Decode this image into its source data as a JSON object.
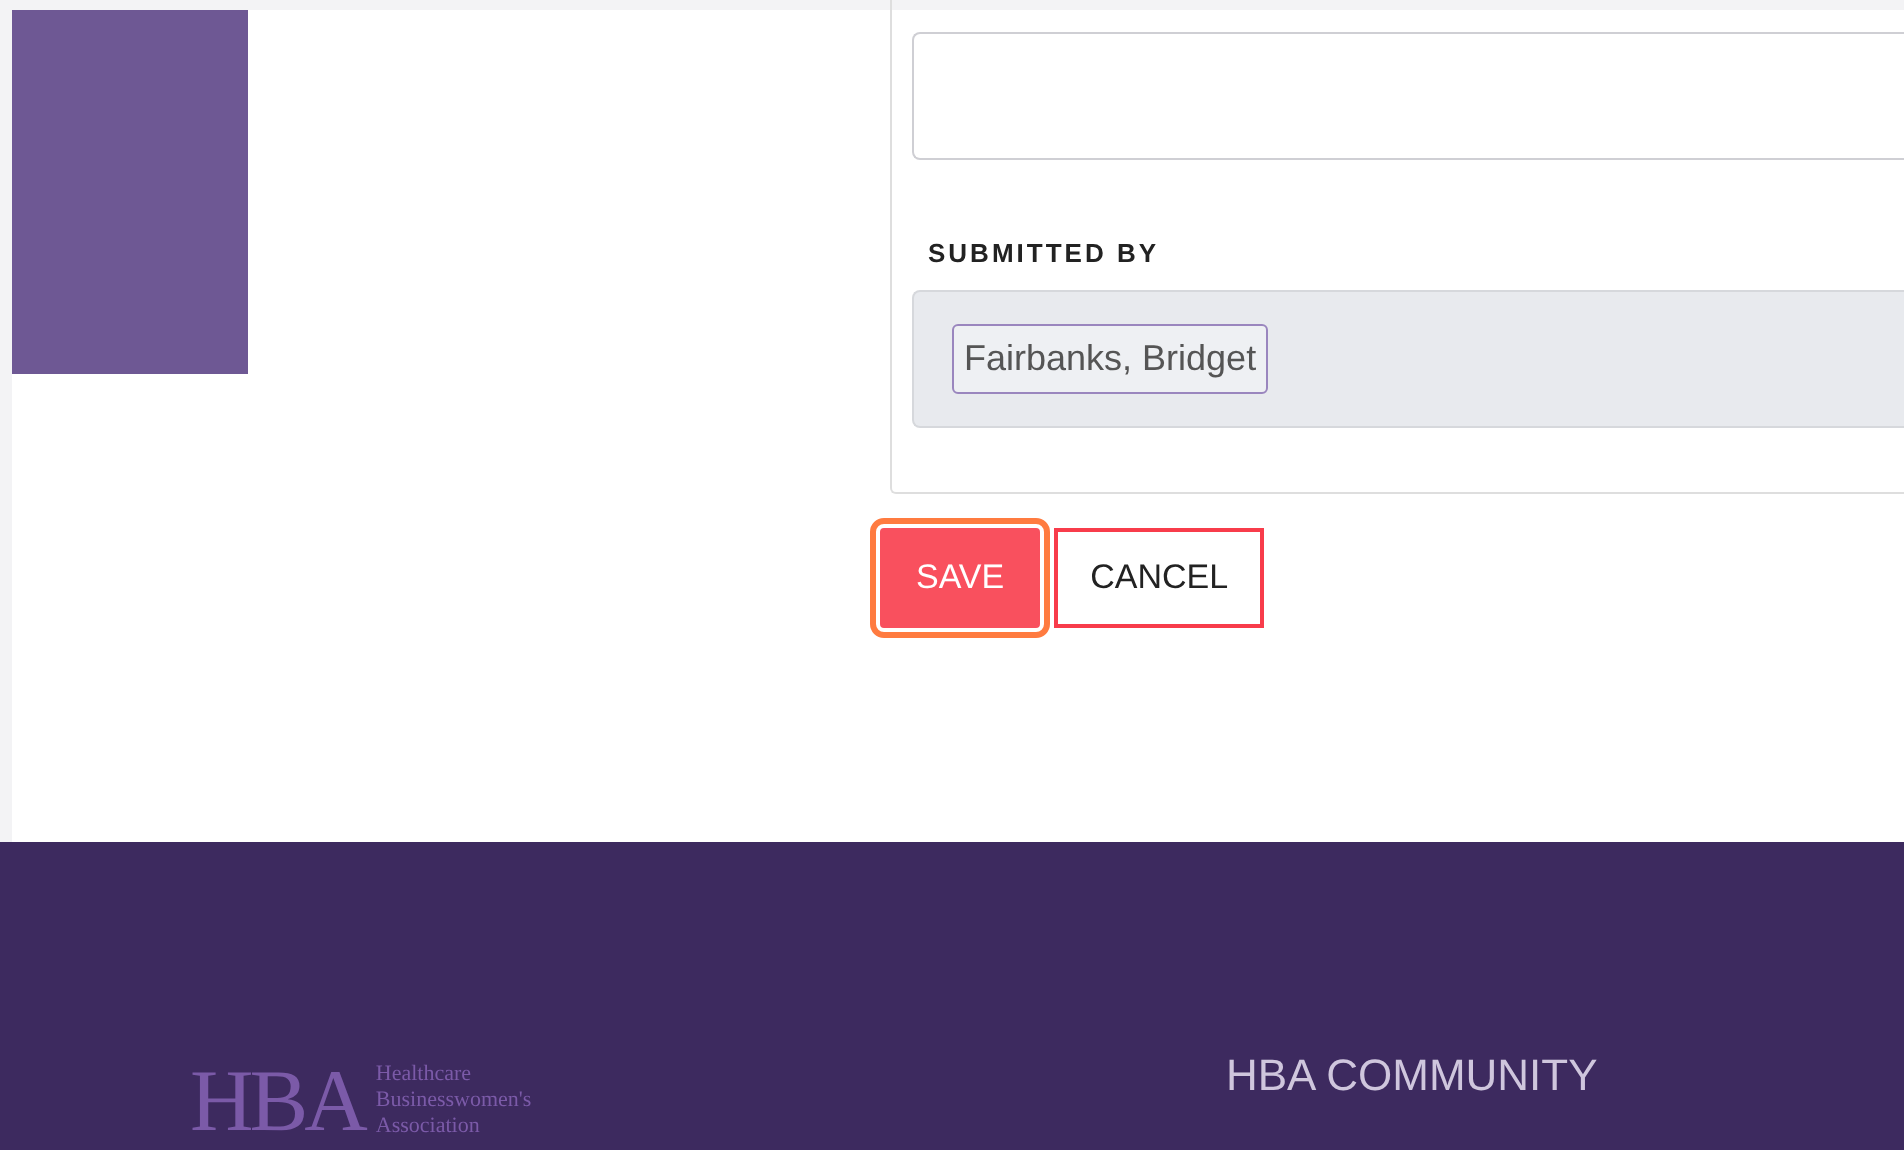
{
  "form": {
    "submitted_by": {
      "label": "SUBMITTED BY",
      "chips": [
        "Fairbanks, Bridget"
      ]
    }
  },
  "buttons": [
    {
      "label": "SAVE",
      "kind": "primary",
      "focused": true
    },
    {
      "label": "CANCEL",
      "kind": "secondary",
      "focused": false
    }
  ],
  "footer": {
    "logo": {
      "mark": "HBA",
      "lines": [
        "Healthcare",
        "Businesswomen's",
        "Association"
      ]
    },
    "heading": "HBA COMMUNITY"
  }
}
